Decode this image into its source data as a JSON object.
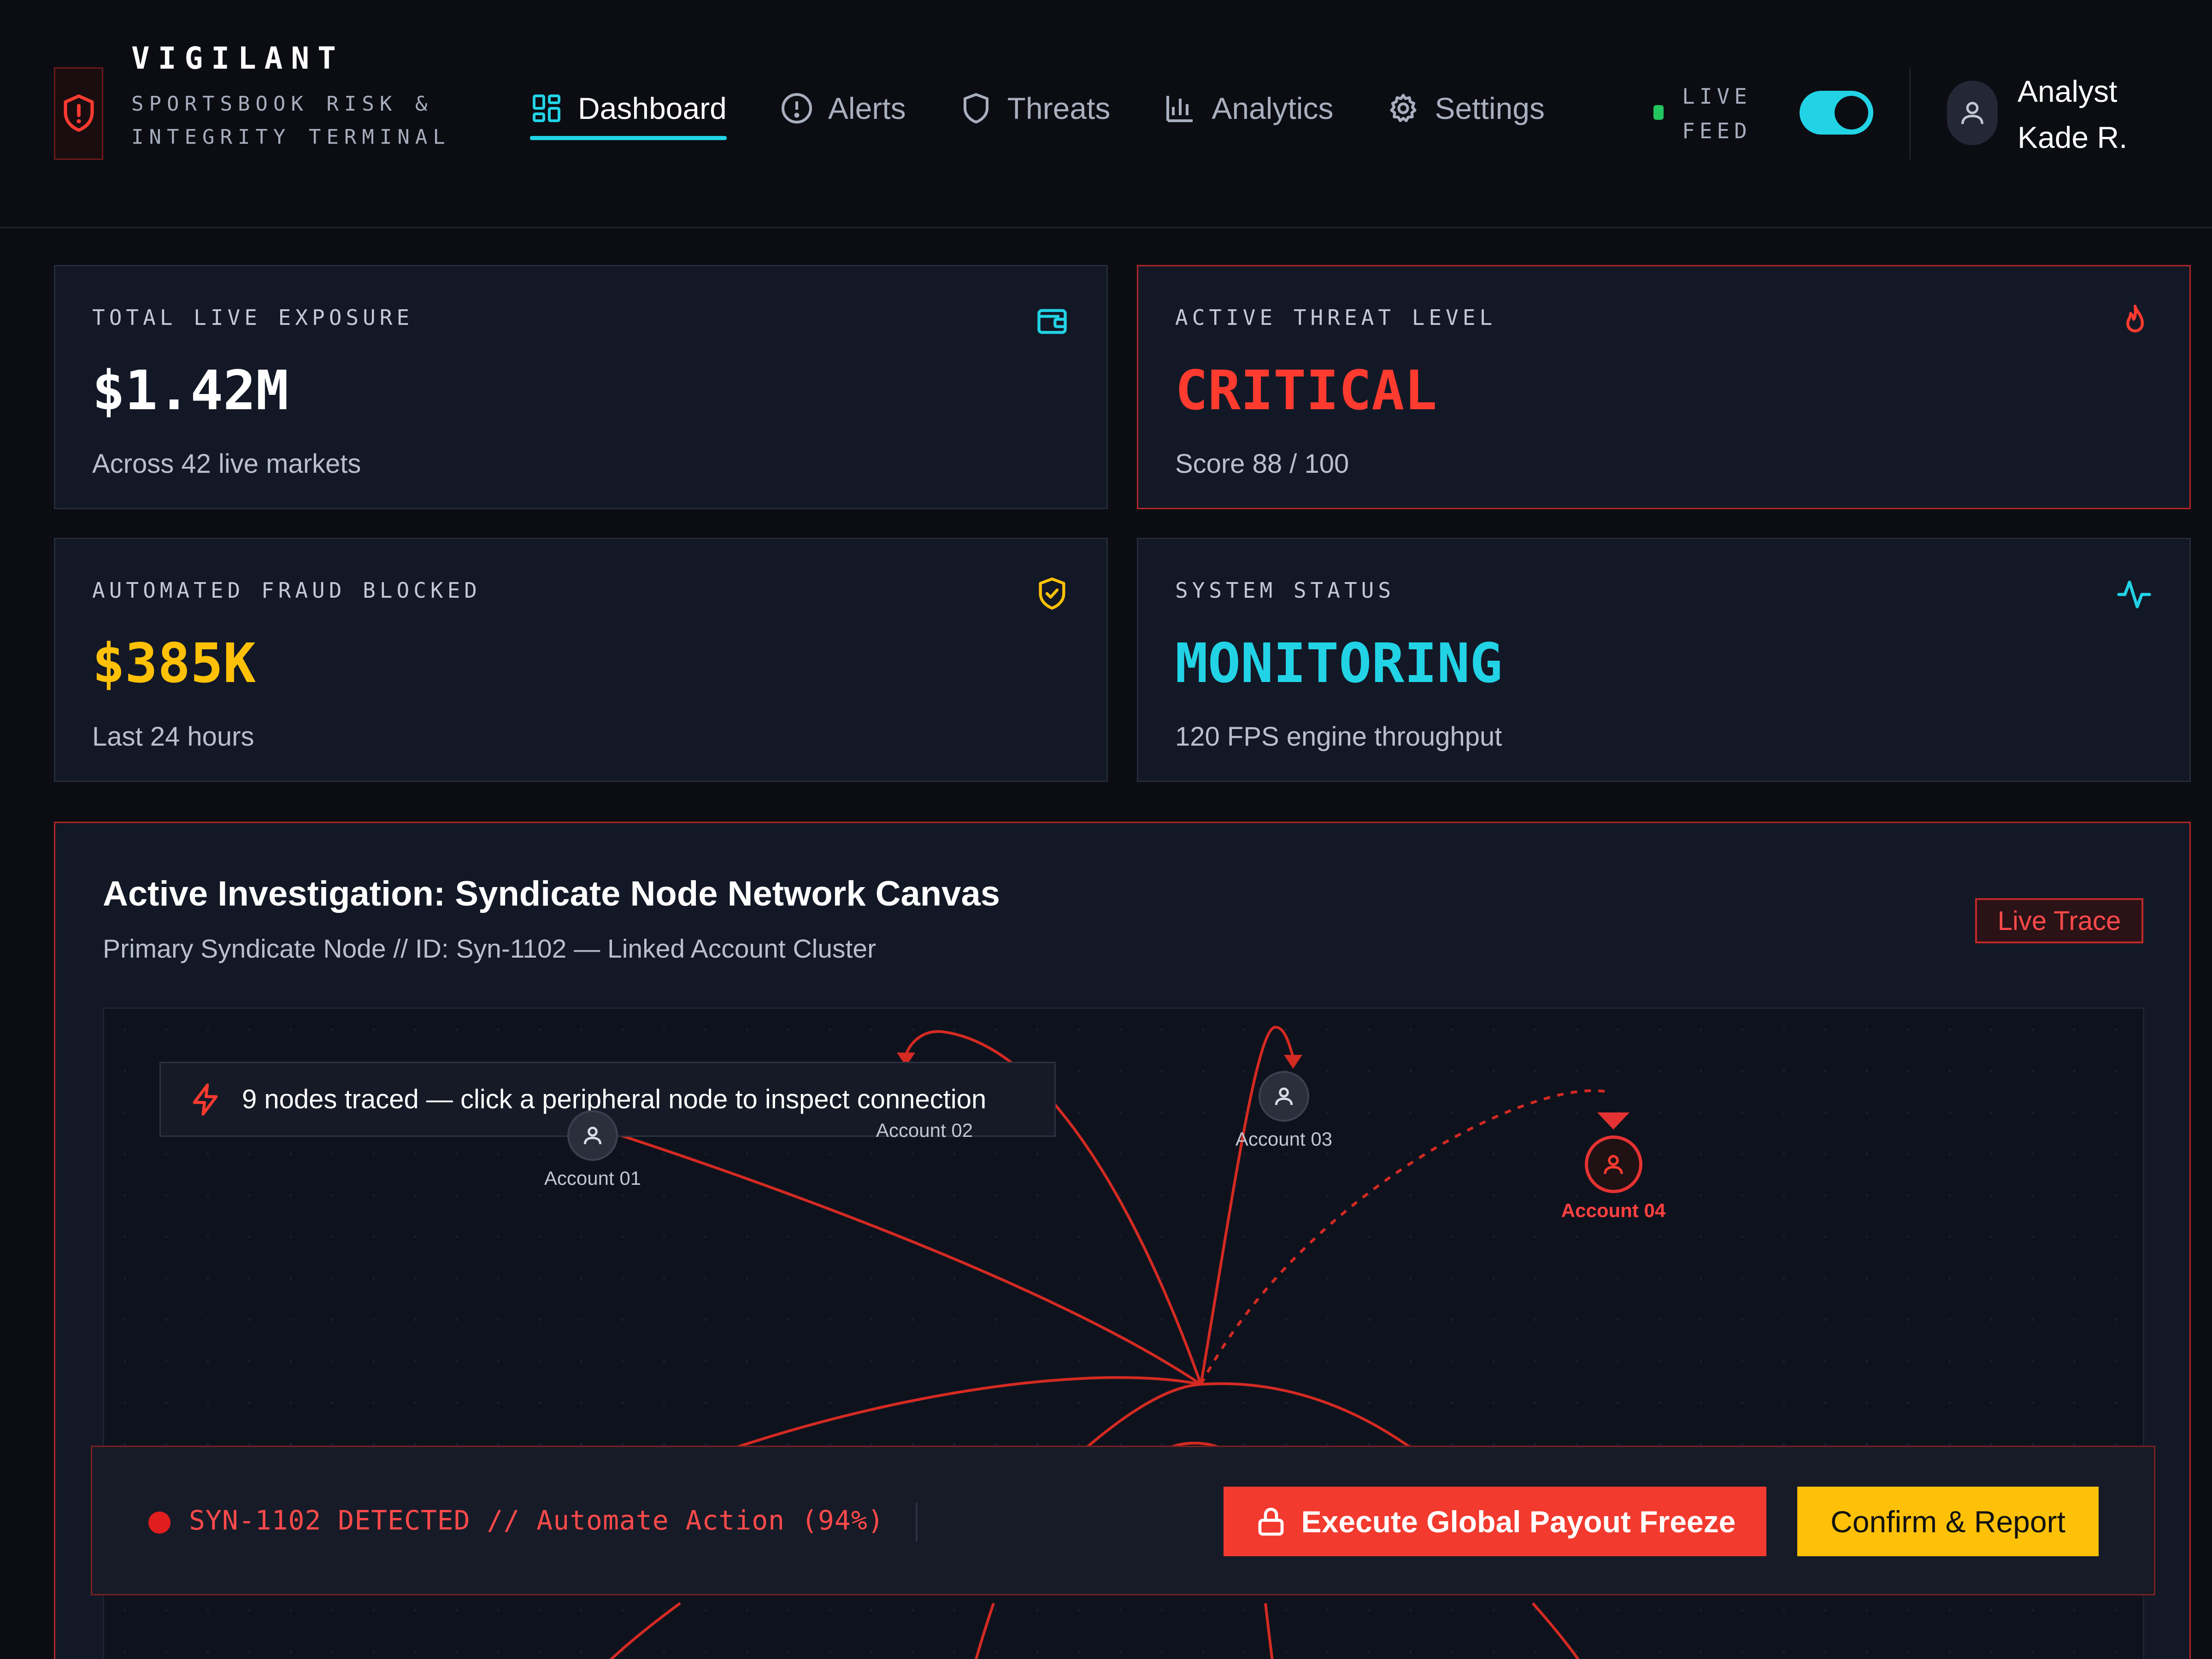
{
  "brand": {
    "name": "VIGILANT",
    "subtitle": "SPORTSBOOK RISK & INTEGRITY TERMINAL"
  },
  "nav": {
    "items": [
      {
        "label": "Dashboard",
        "icon": "grid-icon",
        "active": true
      },
      {
        "label": "Alerts",
        "icon": "alert-circle-icon"
      },
      {
        "label": "Threats",
        "icon": "shield-icon"
      },
      {
        "label": "Analytics",
        "icon": "bar-chart-icon"
      },
      {
        "label": "Settings",
        "icon": "gear-icon"
      }
    ]
  },
  "live_feed": {
    "label_line1": "LIVE",
    "label_line2": "FEED",
    "enabled": true
  },
  "user": {
    "line1": "Analyst",
    "line2": "Kade R."
  },
  "cards": {
    "exposure": {
      "label": "TOTAL LIVE EXPOSURE",
      "value": "$1.42M",
      "sub": "Across 42 live markets",
      "icon": "wallet-icon"
    },
    "threat": {
      "label": "ACTIVE THREAT LEVEL",
      "value": "CRITICAL",
      "sub": "Score 88 / 100",
      "icon": "flame-icon"
    },
    "fraud": {
      "label": "AUTOMATED FRAUD BLOCKED",
      "value": "$385K",
      "sub": "Last 24 hours",
      "icon": "shield-check-icon"
    },
    "status": {
      "label": "SYSTEM STATUS",
      "value": "MONITORING",
      "sub": "120 FPS engine throughput",
      "icon": "activity-icon"
    }
  },
  "colors": {
    "accent_cyan": "#22d3e6",
    "danger_red": "#ff3b30",
    "warning_yellow": "#ffc107",
    "panel_bg": "#131826"
  },
  "investigation": {
    "title": "Active Investigation: Syndicate Node Network Canvas",
    "subtitle": "Primary Syndicate Node // ID: Syn-1102 — Linked Account Cluster",
    "badge": "Live Trace",
    "banner": "9 nodes traced — click a peripheral node to inspect connection",
    "nodes": [
      {
        "label": "Account 01"
      },
      {
        "label": "Account 02"
      },
      {
        "label": "Account 03"
      },
      {
        "label": "Account 04",
        "highlighted": true
      }
    ]
  },
  "action_bar": {
    "alert_text": "SYN-1102 DETECTED // Automate Action (94%)",
    "freeze_button": "Execute Global Payout Freeze",
    "confirm_button": "Confirm & Report"
  }
}
